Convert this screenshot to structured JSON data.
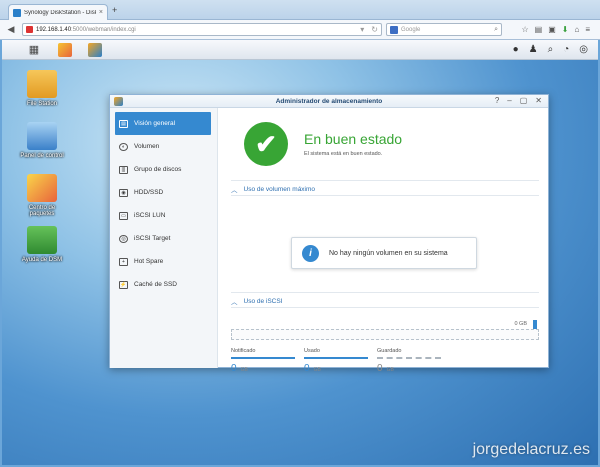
{
  "browser": {
    "tab_title": "Synology DiskStation - DiskSta...",
    "tab_close": "×",
    "new_tab": "+",
    "url_host": "192.168.1.40",
    "url_rest": ":5000/webman/index.cgi",
    "search_placeholder": "Google"
  },
  "desktop": {
    "icons": [
      {
        "label": "File Station",
        "color": "#f0b43c"
      },
      {
        "label": "Panel de control",
        "color": "#4a90d9"
      },
      {
        "label": "Centro de paquetes",
        "color": "#f5c431"
      },
      {
        "label": "Ayuda de DSM",
        "color": "#3aa13f"
      }
    ],
    "watermark": "jorgedelacruz.es"
  },
  "window": {
    "title": "Administrador de almacenamiento"
  },
  "sidebar": {
    "items": [
      {
        "label": "Visión general",
        "active": true
      },
      {
        "label": "Volumen"
      },
      {
        "label": "Grupo de discos"
      },
      {
        "label": "HDD/SSD"
      },
      {
        "label": "iSCSI LUN"
      },
      {
        "label": "iSCSI Target"
      },
      {
        "label": "Hot Spare"
      },
      {
        "label": "Caché de SSD"
      }
    ]
  },
  "health": {
    "title": "En buen estado",
    "subtitle": "El sistema está en buen estado.",
    "color": "#38a535"
  },
  "volume_section": {
    "heading": "Uso de volumen máximo",
    "empty_message": "No hay ningún volumen en su sistema"
  },
  "iscsi_section": {
    "heading": "Uso de iSCSI",
    "capacity_label": "0 GB",
    "stats": [
      {
        "label": "Notificado",
        "value": "0",
        "unit": "GB"
      },
      {
        "label": "Usado",
        "value": "0",
        "unit": "GB"
      },
      {
        "label": "Guardado",
        "value": "0",
        "unit": "GB"
      }
    ]
  },
  "colors": {
    "accent": "#3589d0",
    "ok": "#38a535"
  }
}
